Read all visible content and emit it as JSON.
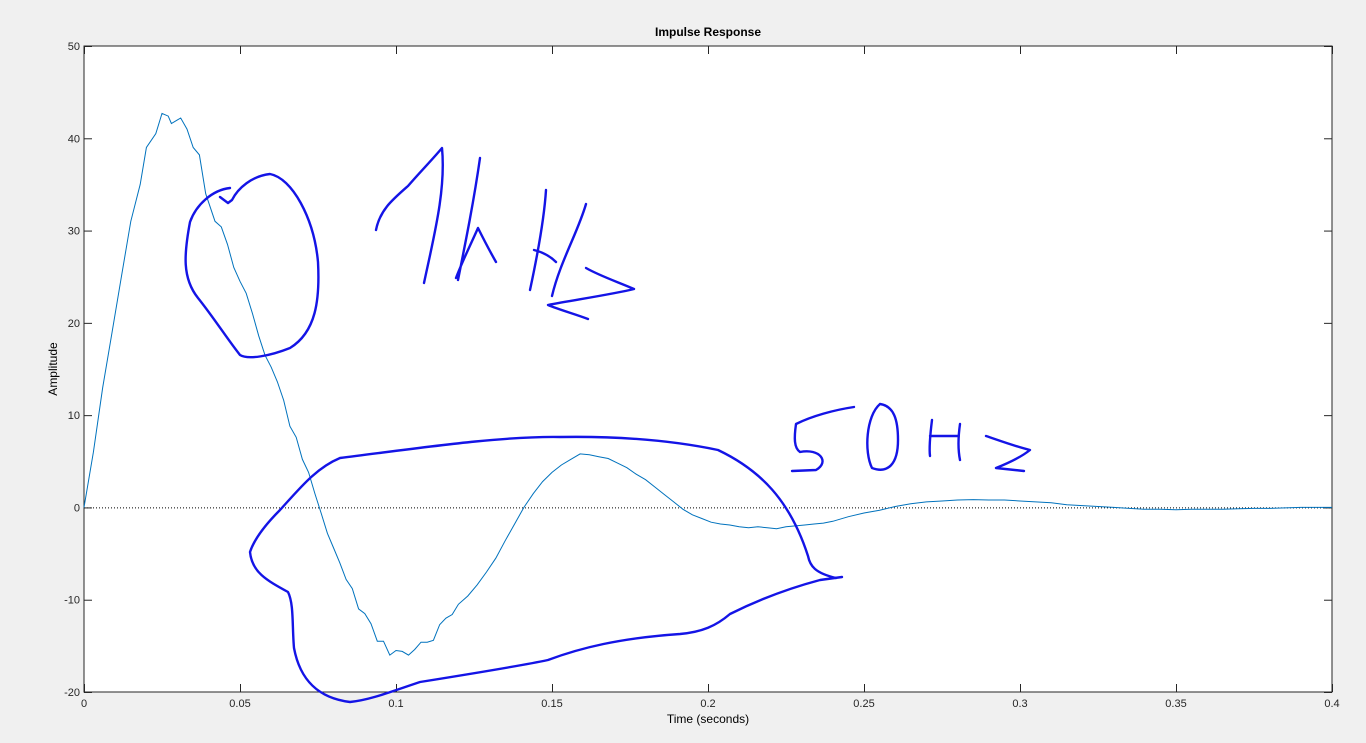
{
  "chart_data": {
    "type": "line",
    "title": "Impulse Response",
    "xlabel": "Time (seconds)",
    "ylabel": "Amplitude",
    "xlim": [
      0,
      0.4
    ],
    "ylim": [
      -20,
      50
    ],
    "x_ticks": [
      0,
      0.05,
      0.1,
      0.15,
      0.2,
      0.25,
      0.3,
      0.35,
      0.4
    ],
    "x_tick_labels": [
      "0",
      "0.05",
      "0.1",
      "0.15",
      "0.2",
      "0.25",
      "0.3",
      "0.35",
      "0.4"
    ],
    "y_ticks": [
      -20,
      -10,
      0,
      10,
      20,
      30,
      40,
      50
    ],
    "y_tick_labels": [
      "-20",
      "-10",
      "0",
      "10",
      "20",
      "30",
      "40",
      "50"
    ],
    "grid": false,
    "zero_line": true,
    "series": [
      {
        "color": "#0072bd",
        "points": [
          [
            0,
            0
          ],
          [
            0.003,
            6
          ],
          [
            0.006,
            13
          ],
          [
            0.009,
            19
          ],
          [
            0.012,
            25
          ],
          [
            0.015,
            31
          ],
          [
            0.018,
            35
          ],
          [
            0.02,
            39
          ],
          [
            0.023,
            40.5
          ],
          [
            0.025,
            42.7
          ],
          [
            0.027,
            42.4
          ],
          [
            0.028,
            41.6
          ],
          [
            0.03,
            42
          ],
          [
            0.031,
            42.2
          ],
          [
            0.033,
            41
          ],
          [
            0.035,
            39
          ],
          [
            0.037,
            38.2
          ],
          [
            0.039,
            34
          ],
          [
            0.042,
            31
          ],
          [
            0.044,
            30.4
          ],
          [
            0.046,
            28.5
          ],
          [
            0.048,
            26
          ],
          [
            0.05,
            24.5
          ],
          [
            0.052,
            23.2
          ],
          [
            0.054,
            21
          ],
          [
            0.056,
            18.6
          ],
          [
            0.058,
            16.5
          ],
          [
            0.06,
            15.2
          ],
          [
            0.062,
            13.6
          ],
          [
            0.064,
            11.6
          ],
          [
            0.066,
            8.8
          ],
          [
            0.068,
            7.6
          ],
          [
            0.07,
            5.2
          ],
          [
            0.072,
            3.8
          ],
          [
            0.074,
            1.5
          ],
          [
            0.076,
            -0.6
          ],
          [
            0.078,
            -2.8
          ],
          [
            0.08,
            -4.4
          ],
          [
            0.082,
            -6
          ],
          [
            0.084,
            -7.8
          ],
          [
            0.086,
            -8.8
          ],
          [
            0.088,
            -11
          ],
          [
            0.09,
            -11.5
          ],
          [
            0.092,
            -12.6
          ],
          [
            0.094,
            -14.5
          ],
          [
            0.096,
            -14.5
          ],
          [
            0.098,
            -16
          ],
          [
            0.1,
            -15.5
          ],
          [
            0.102,
            -15.6
          ],
          [
            0.104,
            -16
          ],
          [
            0.106,
            -15.4
          ],
          [
            0.108,
            -14.6
          ],
          [
            0.11,
            -14.6
          ],
          [
            0.112,
            -14.4
          ],
          [
            0.114,
            -12.7
          ],
          [
            0.116,
            -12
          ],
          [
            0.118,
            -11.6
          ],
          [
            0.12,
            -10.5
          ],
          [
            0.123,
            -9.6
          ],
          [
            0.126,
            -8.4
          ],
          [
            0.129,
            -7
          ],
          [
            0.132,
            -5.5
          ],
          [
            0.135,
            -3.6
          ],
          [
            0.138,
            -1.8
          ],
          [
            0.141,
            0
          ],
          [
            0.144,
            1.5
          ],
          [
            0.147,
            2.8
          ],
          [
            0.15,
            3.8
          ],
          [
            0.153,
            4.6
          ],
          [
            0.156,
            5.2
          ],
          [
            0.159,
            5.8
          ],
          [
            0.162,
            5.7
          ],
          [
            0.165,
            5.5
          ],
          [
            0.168,
            5.3
          ],
          [
            0.171,
            4.8
          ],
          [
            0.174,
            4.3
          ],
          [
            0.177,
            3.6
          ],
          [
            0.18,
            3
          ],
          [
            0.183,
            2.2
          ],
          [
            0.186,
            1.4
          ],
          [
            0.189,
            0.6
          ],
          [
            0.192,
            -0.2
          ],
          [
            0.195,
            -0.8
          ],
          [
            0.198,
            -1.2
          ],
          [
            0.201,
            -1.6
          ],
          [
            0.204,
            -1.8
          ],
          [
            0.207,
            -1.9
          ],
          [
            0.21,
            -2.1
          ],
          [
            0.213,
            -2.2
          ],
          [
            0.216,
            -2.1
          ],
          [
            0.219,
            -2.2
          ],
          [
            0.222,
            -2.3
          ],
          [
            0.225,
            -2.1
          ],
          [
            0.228,
            -2
          ],
          [
            0.231,
            -1.9
          ],
          [
            0.234,
            -1.8
          ],
          [
            0.237,
            -1.7
          ],
          [
            0.24,
            -1.5
          ],
          [
            0.245,
            -1
          ],
          [
            0.25,
            -0.6
          ],
          [
            0.255,
            -0.3
          ],
          [
            0.26,
            0.1
          ],
          [
            0.265,
            0.4
          ],
          [
            0.27,
            0.6
          ],
          [
            0.275,
            0.7
          ],
          [
            0.28,
            0.8
          ],
          [
            0.285,
            0.85
          ],
          [
            0.29,
            0.8
          ],
          [
            0.295,
            0.8
          ],
          [
            0.3,
            0.7
          ],
          [
            0.305,
            0.6
          ],
          [
            0.31,
            0.5
          ],
          [
            0.315,
            0.3
          ],
          [
            0.32,
            0.2
          ],
          [
            0.325,
            0.1
          ],
          [
            0.33,
            0
          ],
          [
            0.335,
            -0.1
          ],
          [
            0.34,
            -0.2
          ],
          [
            0.345,
            -0.2
          ],
          [
            0.35,
            -0.25
          ],
          [
            0.355,
            -0.2
          ],
          [
            0.36,
            -0.2
          ],
          [
            0.365,
            -0.2
          ],
          [
            0.37,
            -0.15
          ],
          [
            0.375,
            -0.1
          ],
          [
            0.38,
            -0.1
          ],
          [
            0.385,
            -0.05
          ],
          [
            0.39,
            0
          ],
          [
            0.395,
            0
          ],
          [
            0.4,
            0
          ]
        ]
      }
    ]
  }
}
